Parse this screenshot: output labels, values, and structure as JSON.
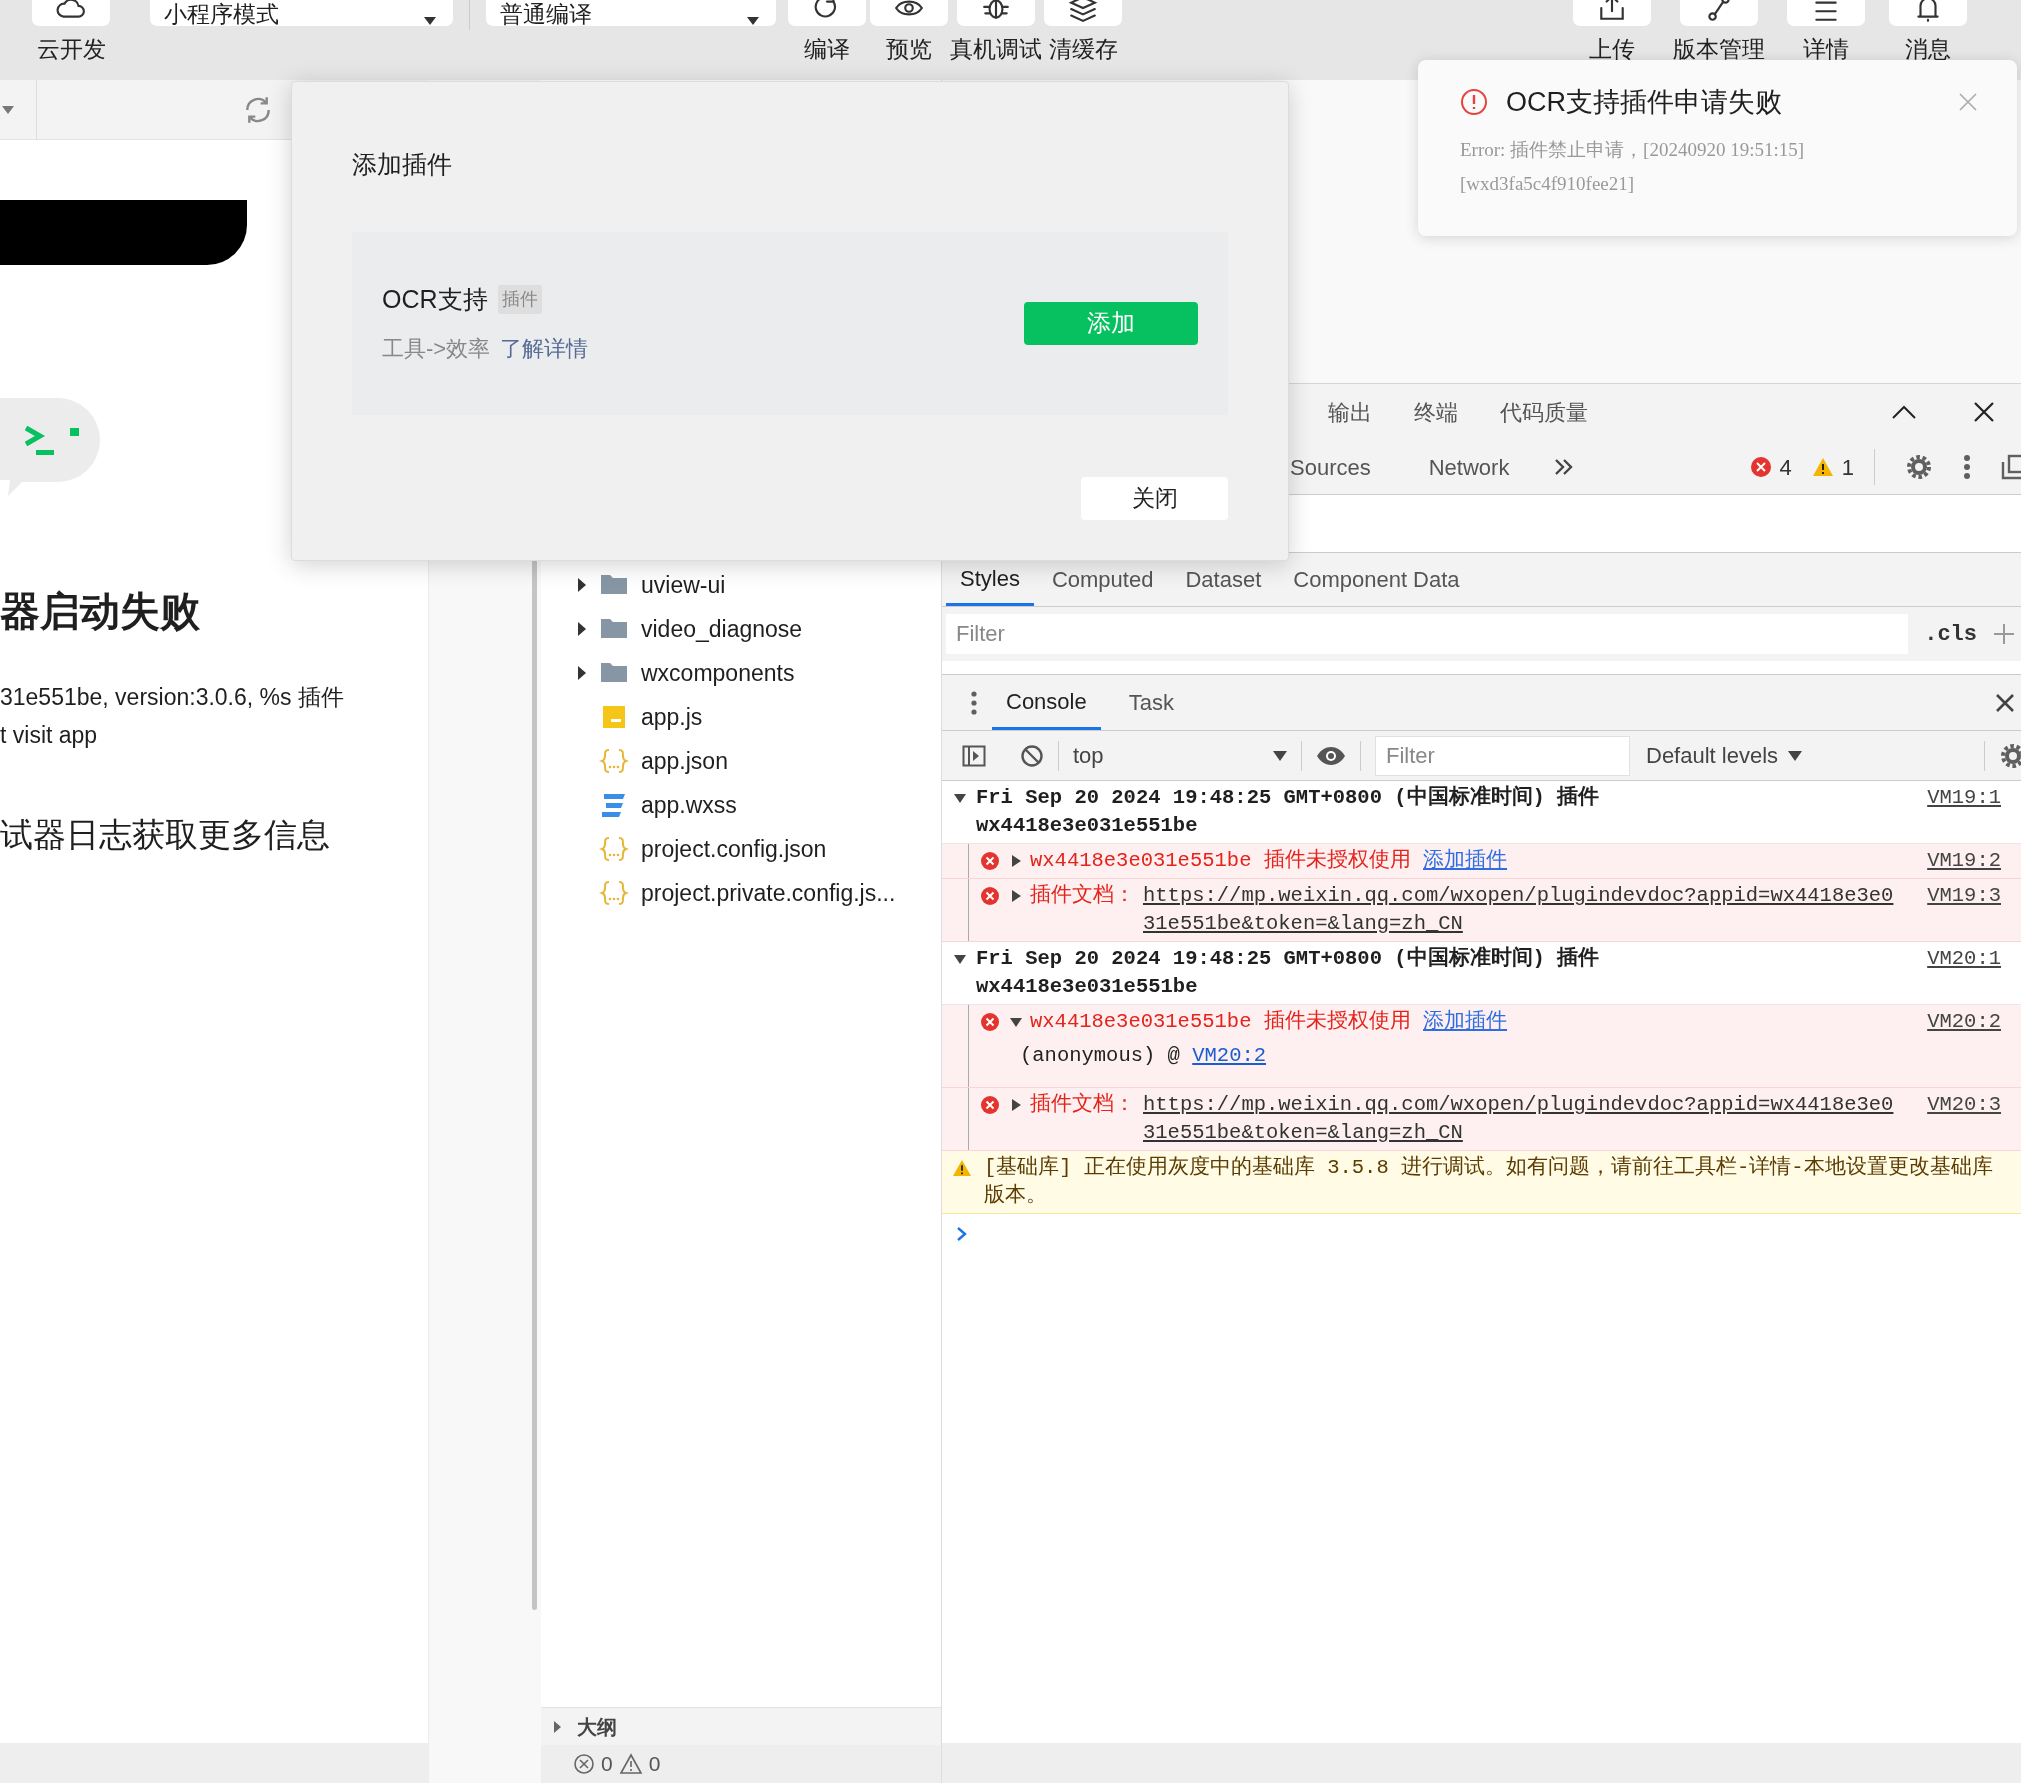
{
  "toolbar": {
    "left_actions": [
      {
        "label": "云开发",
        "kind": "cloud"
      }
    ],
    "mode_select": {
      "value": "小程序模式"
    },
    "compile_select": {
      "value": "普通编译"
    },
    "actions": [
      {
        "label": "编译",
        "kind": "refresh"
      },
      {
        "label": "预览",
        "kind": "eye"
      },
      {
        "label": "真机调试",
        "kind": "bug"
      },
      {
        "label": "清缓存",
        "kind": "layers"
      }
    ],
    "right_actions": [
      {
        "label": "上传",
        "kind": "upload"
      },
      {
        "label": "版本管理",
        "kind": "branch"
      },
      {
        "label": "详情",
        "kind": "menu"
      },
      {
        "label": "消息",
        "kind": "bell"
      }
    ]
  },
  "simulator": {
    "heading": "器启动失败",
    "details": [
      "31e551be, version:3.0.6, %s 插件",
      "t visit app"
    ],
    "hint": "试器日志获取更多信息"
  },
  "file_tree": {
    "items": [
      {
        "name": "uview-ui",
        "kind": "folder",
        "expanded": false
      },
      {
        "name": "video_diagnose",
        "kind": "folder",
        "expanded": false
      },
      {
        "name": "wxcomponents",
        "kind": "folder",
        "expanded": false
      },
      {
        "name": "app.js",
        "kind": "js"
      },
      {
        "name": "app.json",
        "kind": "json"
      },
      {
        "name": "app.wxss",
        "kind": "wxss"
      },
      {
        "name": "project.config.json",
        "kind": "json"
      },
      {
        "name": "project.private.config.js...",
        "kind": "json"
      }
    ],
    "outline": {
      "label": "大纲",
      "expanded": false
    },
    "problems": {
      "errors": "0",
      "warnings": "0"
    }
  },
  "dialog": {
    "title": "添加插件",
    "plugin": {
      "name": "OCR支持",
      "tag": "插件",
      "category": "工具->效率",
      "link": "了解详情"
    },
    "add_button": "添加",
    "close_button": "关闭"
  },
  "toast": {
    "title": "OCR支持插件申请失败",
    "message_lines": [
      "Error: 插件禁止申请，[20240920 19:51:15]",
      "[wxd3fa5c4f910fee21]"
    ]
  },
  "devtools": {
    "panel_tabs": [
      {
        "label": "输出",
        "selected": false
      },
      {
        "label": "终端",
        "selected": false
      },
      {
        "label": "代码质量",
        "selected": false
      }
    ],
    "tool_tabs": [
      {
        "label": "Sources",
        "selected": false
      },
      {
        "label": "Network",
        "selected": false
      }
    ],
    "error_count": "4",
    "warning_count": "1",
    "sidebar_tabs": [
      {
        "label": "Styles",
        "selected": true
      },
      {
        "label": "Computed",
        "selected": false
      },
      {
        "label": "Dataset",
        "selected": false
      },
      {
        "label": "Component Data",
        "selected": false
      }
    ],
    "styles_filter": {
      "placeholder": "Filter"
    },
    "cls_button": ".cls",
    "drawer_tabs": [
      {
        "label": "Console",
        "selected": true
      },
      {
        "label": "Task",
        "selected": false
      }
    ],
    "context_select": {
      "value": "top"
    },
    "console_filter": {
      "placeholder": "Filter"
    },
    "levels_select": {
      "value": "Default levels"
    },
    "messages": [
      {
        "kind": "group",
        "expanded": true,
        "lines": [
          "Fri Sep 20 2024 19:48:25 GMT+0800 (中国标准时间) 插件",
          "wx4418e3e031e551be"
        ],
        "source": "VM19:1",
        "children": [
          {
            "kind": "error",
            "expanded": false,
            "id": "wx4418e3e031e551be",
            "text": "插件未授权使用",
            "link": "添加插件",
            "source": "VM19:2"
          },
          {
            "kind": "error",
            "expanded": false,
            "label": "插件文档：",
            "url": "https://mp.weixin.qq.com/wxopen/plugindevdoc?appid=wx4418e3e031e551be&token=&lang=zh_CN",
            "source": "VM19:3"
          }
        ]
      },
      {
        "kind": "group",
        "expanded": true,
        "lines": [
          "Fri Sep 20 2024 19:48:25 GMT+0800 (中国标准时间) 插件",
          "wx4418e3e031e551be"
        ],
        "source": "VM20:1",
        "children": [
          {
            "kind": "error",
            "expanded": true,
            "id": "wx4418e3e031e551be",
            "text": "插件未授权使用",
            "link": "添加插件",
            "source": "VM20:2",
            "stack": {
              "text": "(anonymous) @",
              "link": "VM20:2"
            }
          },
          {
            "kind": "error",
            "expanded": false,
            "label": "插件文档：",
            "url": "https://mp.weixin.qq.com/wxopen/plugindevdoc?appid=wx4418e3e031e551be&token=&lang=zh_CN",
            "source": "VM20:3"
          }
        ]
      },
      {
        "kind": "warning",
        "text": "[基础库] 正在使用灰度中的基础库 3.5.8 进行调试。如有问题，请前往工具栏-详情-本地设置更改基础库版本。"
      }
    ]
  }
}
